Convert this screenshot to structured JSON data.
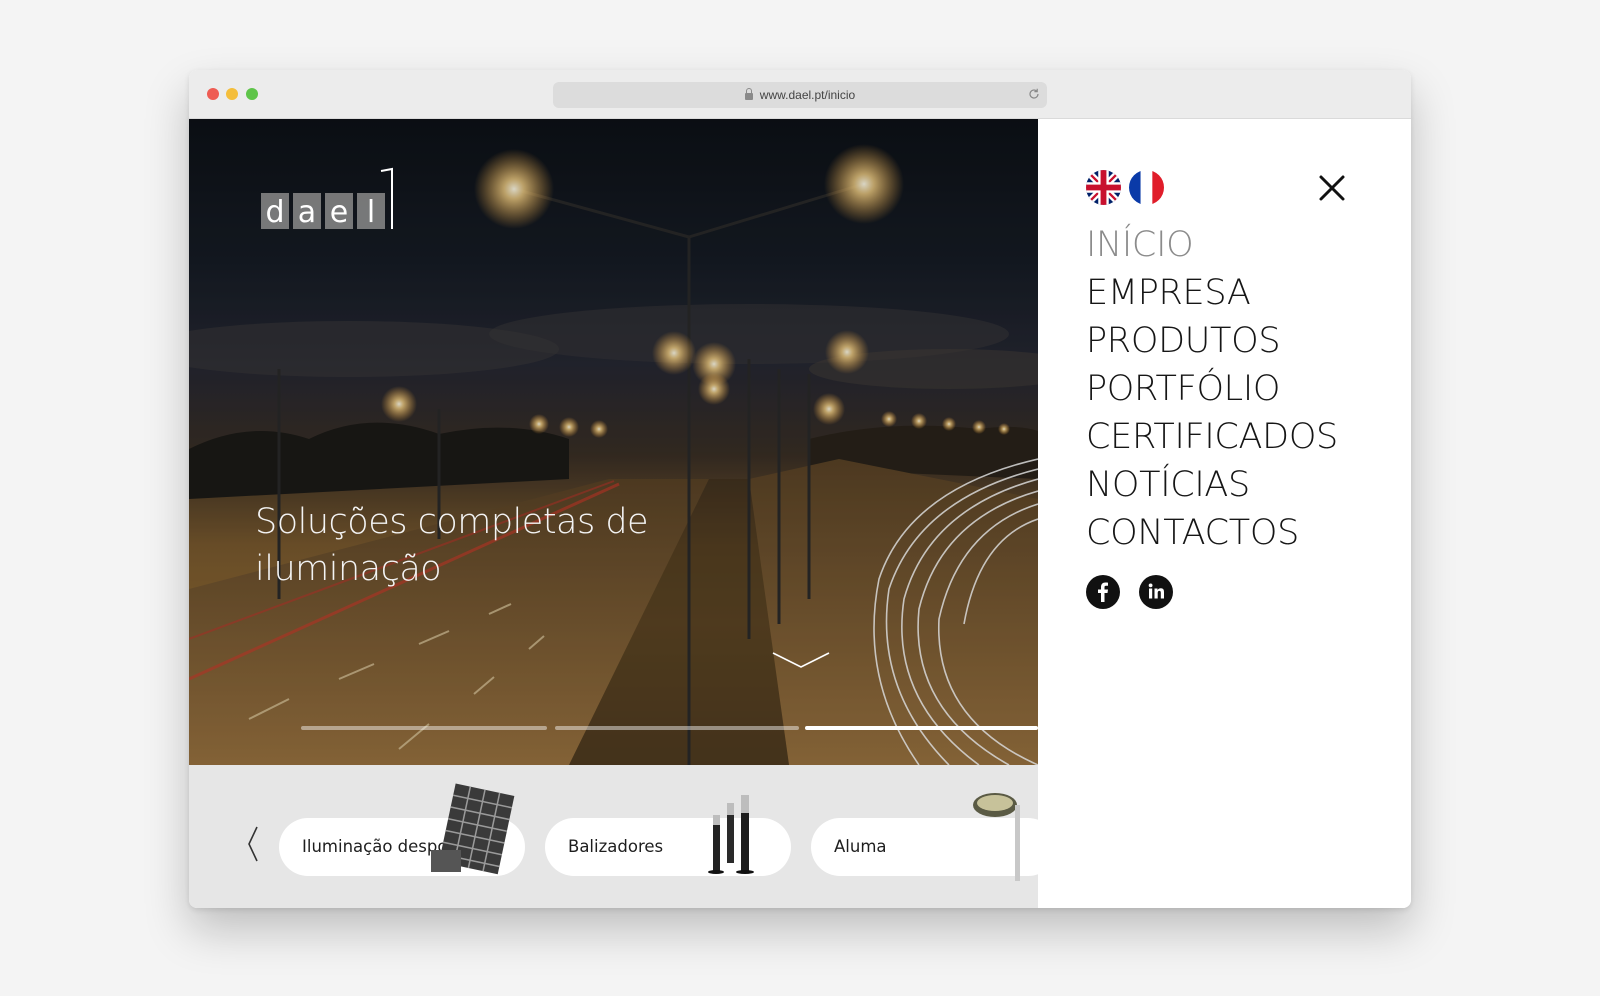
{
  "browser": {
    "url": "www.dael.pt/inicio"
  },
  "hero": {
    "logo_text": "dael",
    "headline": "Soluções completas de iluminação",
    "slides_total": 3,
    "active_slide": 3
  },
  "categories": [
    {
      "label": "Iluminação desportiva"
    },
    {
      "label": "Balizadores"
    },
    {
      "label": "Aluma"
    }
  ],
  "menu": {
    "languages": [
      {
        "code": "en",
        "icon": "uk-flag-icon"
      },
      {
        "code": "fr",
        "icon": "fr-flag-icon"
      }
    ],
    "items": [
      {
        "label": "INÍCIO",
        "active": true
      },
      {
        "label": "EMPRESA",
        "active": false
      },
      {
        "label": "PRODUTOS",
        "active": false
      },
      {
        "label": "PORTFÓLIO",
        "active": false
      },
      {
        "label": "CERTIFICADOS",
        "active": false
      },
      {
        "label": "NOTÍCIAS",
        "active": false
      },
      {
        "label": "CONTACTOS",
        "active": false
      }
    ],
    "social": [
      {
        "network": "facebook",
        "icon": "facebook-icon"
      },
      {
        "network": "linkedin",
        "icon": "linkedin-icon"
      }
    ]
  },
  "colors": {
    "menu_text": "#161616",
    "menu_active": "#8b8b8b",
    "strip_background": "#e6e6e6"
  }
}
